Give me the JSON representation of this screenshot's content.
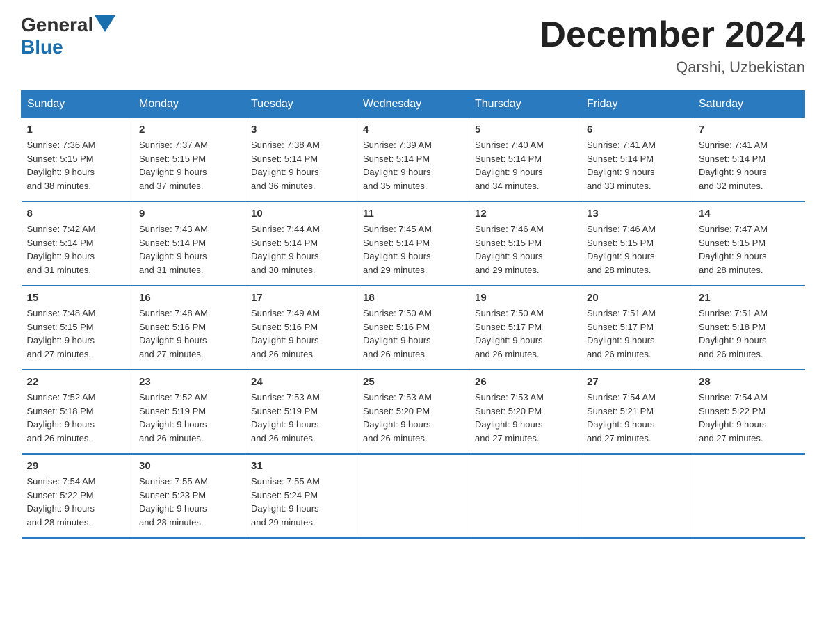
{
  "logo": {
    "general": "General",
    "blue": "Blue"
  },
  "title": "December 2024",
  "location": "Qarshi, Uzbekistan",
  "days_of_week": [
    "Sunday",
    "Monday",
    "Tuesday",
    "Wednesday",
    "Thursday",
    "Friday",
    "Saturday"
  ],
  "weeks": [
    [
      {
        "day": "1",
        "sunrise": "7:36 AM",
        "sunset": "5:15 PM",
        "daylight": "9 hours and 38 minutes."
      },
      {
        "day": "2",
        "sunrise": "7:37 AM",
        "sunset": "5:15 PM",
        "daylight": "9 hours and 37 minutes."
      },
      {
        "day": "3",
        "sunrise": "7:38 AM",
        "sunset": "5:14 PM",
        "daylight": "9 hours and 36 minutes."
      },
      {
        "day": "4",
        "sunrise": "7:39 AM",
        "sunset": "5:14 PM",
        "daylight": "9 hours and 35 minutes."
      },
      {
        "day": "5",
        "sunrise": "7:40 AM",
        "sunset": "5:14 PM",
        "daylight": "9 hours and 34 minutes."
      },
      {
        "day": "6",
        "sunrise": "7:41 AM",
        "sunset": "5:14 PM",
        "daylight": "9 hours and 33 minutes."
      },
      {
        "day": "7",
        "sunrise": "7:41 AM",
        "sunset": "5:14 PM",
        "daylight": "9 hours and 32 minutes."
      }
    ],
    [
      {
        "day": "8",
        "sunrise": "7:42 AM",
        "sunset": "5:14 PM",
        "daylight": "9 hours and 31 minutes."
      },
      {
        "day": "9",
        "sunrise": "7:43 AM",
        "sunset": "5:14 PM",
        "daylight": "9 hours and 31 minutes."
      },
      {
        "day": "10",
        "sunrise": "7:44 AM",
        "sunset": "5:14 PM",
        "daylight": "9 hours and 30 minutes."
      },
      {
        "day": "11",
        "sunrise": "7:45 AM",
        "sunset": "5:14 PM",
        "daylight": "9 hours and 29 minutes."
      },
      {
        "day": "12",
        "sunrise": "7:46 AM",
        "sunset": "5:15 PM",
        "daylight": "9 hours and 29 minutes."
      },
      {
        "day": "13",
        "sunrise": "7:46 AM",
        "sunset": "5:15 PM",
        "daylight": "9 hours and 28 minutes."
      },
      {
        "day": "14",
        "sunrise": "7:47 AM",
        "sunset": "5:15 PM",
        "daylight": "9 hours and 28 minutes."
      }
    ],
    [
      {
        "day": "15",
        "sunrise": "7:48 AM",
        "sunset": "5:15 PM",
        "daylight": "9 hours and 27 minutes."
      },
      {
        "day": "16",
        "sunrise": "7:48 AM",
        "sunset": "5:16 PM",
        "daylight": "9 hours and 27 minutes."
      },
      {
        "day": "17",
        "sunrise": "7:49 AM",
        "sunset": "5:16 PM",
        "daylight": "9 hours and 26 minutes."
      },
      {
        "day": "18",
        "sunrise": "7:50 AM",
        "sunset": "5:16 PM",
        "daylight": "9 hours and 26 minutes."
      },
      {
        "day": "19",
        "sunrise": "7:50 AM",
        "sunset": "5:17 PM",
        "daylight": "9 hours and 26 minutes."
      },
      {
        "day": "20",
        "sunrise": "7:51 AM",
        "sunset": "5:17 PM",
        "daylight": "9 hours and 26 minutes."
      },
      {
        "day": "21",
        "sunrise": "7:51 AM",
        "sunset": "5:18 PM",
        "daylight": "9 hours and 26 minutes."
      }
    ],
    [
      {
        "day": "22",
        "sunrise": "7:52 AM",
        "sunset": "5:18 PM",
        "daylight": "9 hours and 26 minutes."
      },
      {
        "day": "23",
        "sunrise": "7:52 AM",
        "sunset": "5:19 PM",
        "daylight": "9 hours and 26 minutes."
      },
      {
        "day": "24",
        "sunrise": "7:53 AM",
        "sunset": "5:19 PM",
        "daylight": "9 hours and 26 minutes."
      },
      {
        "day": "25",
        "sunrise": "7:53 AM",
        "sunset": "5:20 PM",
        "daylight": "9 hours and 26 minutes."
      },
      {
        "day": "26",
        "sunrise": "7:53 AM",
        "sunset": "5:20 PM",
        "daylight": "9 hours and 27 minutes."
      },
      {
        "day": "27",
        "sunrise": "7:54 AM",
        "sunset": "5:21 PM",
        "daylight": "9 hours and 27 minutes."
      },
      {
        "day": "28",
        "sunrise": "7:54 AM",
        "sunset": "5:22 PM",
        "daylight": "9 hours and 27 minutes."
      }
    ],
    [
      {
        "day": "29",
        "sunrise": "7:54 AM",
        "sunset": "5:22 PM",
        "daylight": "9 hours and 28 minutes."
      },
      {
        "day": "30",
        "sunrise": "7:55 AM",
        "sunset": "5:23 PM",
        "daylight": "9 hours and 28 minutes."
      },
      {
        "day": "31",
        "sunrise": "7:55 AM",
        "sunset": "5:24 PM",
        "daylight": "9 hours and 29 minutes."
      },
      null,
      null,
      null,
      null
    ]
  ],
  "labels": {
    "sunrise": "Sunrise:",
    "sunset": "Sunset:",
    "daylight": "Daylight:"
  }
}
